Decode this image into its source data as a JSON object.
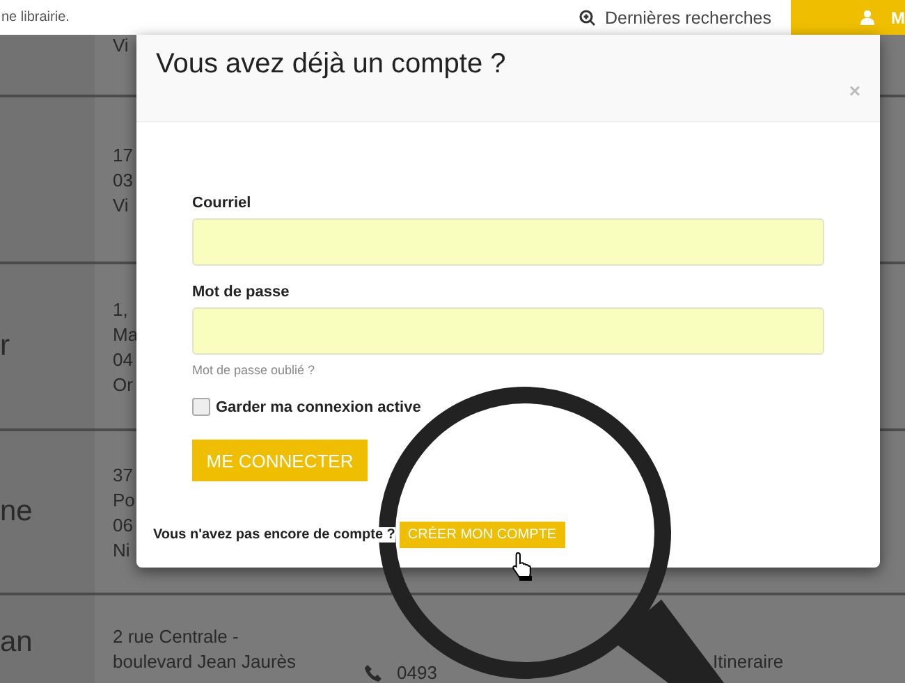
{
  "top_bar": {
    "tagline": "ne librairie.",
    "recent_searches": "Dernières recherches",
    "account_button": "M"
  },
  "background_rows": [
    {
      "column_2": [
        "Vi"
      ]
    },
    {
      "column_2": [
        "17",
        "03",
        "Vi"
      ]
    },
    {
      "column_1": "r",
      "column_2": [
        "1,",
        "Ma",
        "04",
        "Or"
      ]
    },
    {
      "column_1": "ne",
      "column_2": [
        "37",
        "Po",
        "06",
        "Ni"
      ]
    },
    {
      "column_1": "an",
      "column_2": [
        "2 rue Centrale -",
        "boulevard Jean Jaurès"
      ],
      "phone": "0493",
      "link": "Itineraire"
    }
  ],
  "modal": {
    "title": "Vous avez déjà un compte ?",
    "close": "×",
    "fields": [
      {
        "label": "Courriel"
      },
      {
        "label": "Mot de passe"
      }
    ],
    "forgot_link": "Mot de passe oublié ?",
    "remember": {
      "label": "Garder ma connexion active",
      "checked": false
    },
    "submit": "ME CONNECTER",
    "signup_prompt": "Vous n'avez pas encore de compte ?",
    "signup_button": "CRÉER MON COMPTE"
  }
}
